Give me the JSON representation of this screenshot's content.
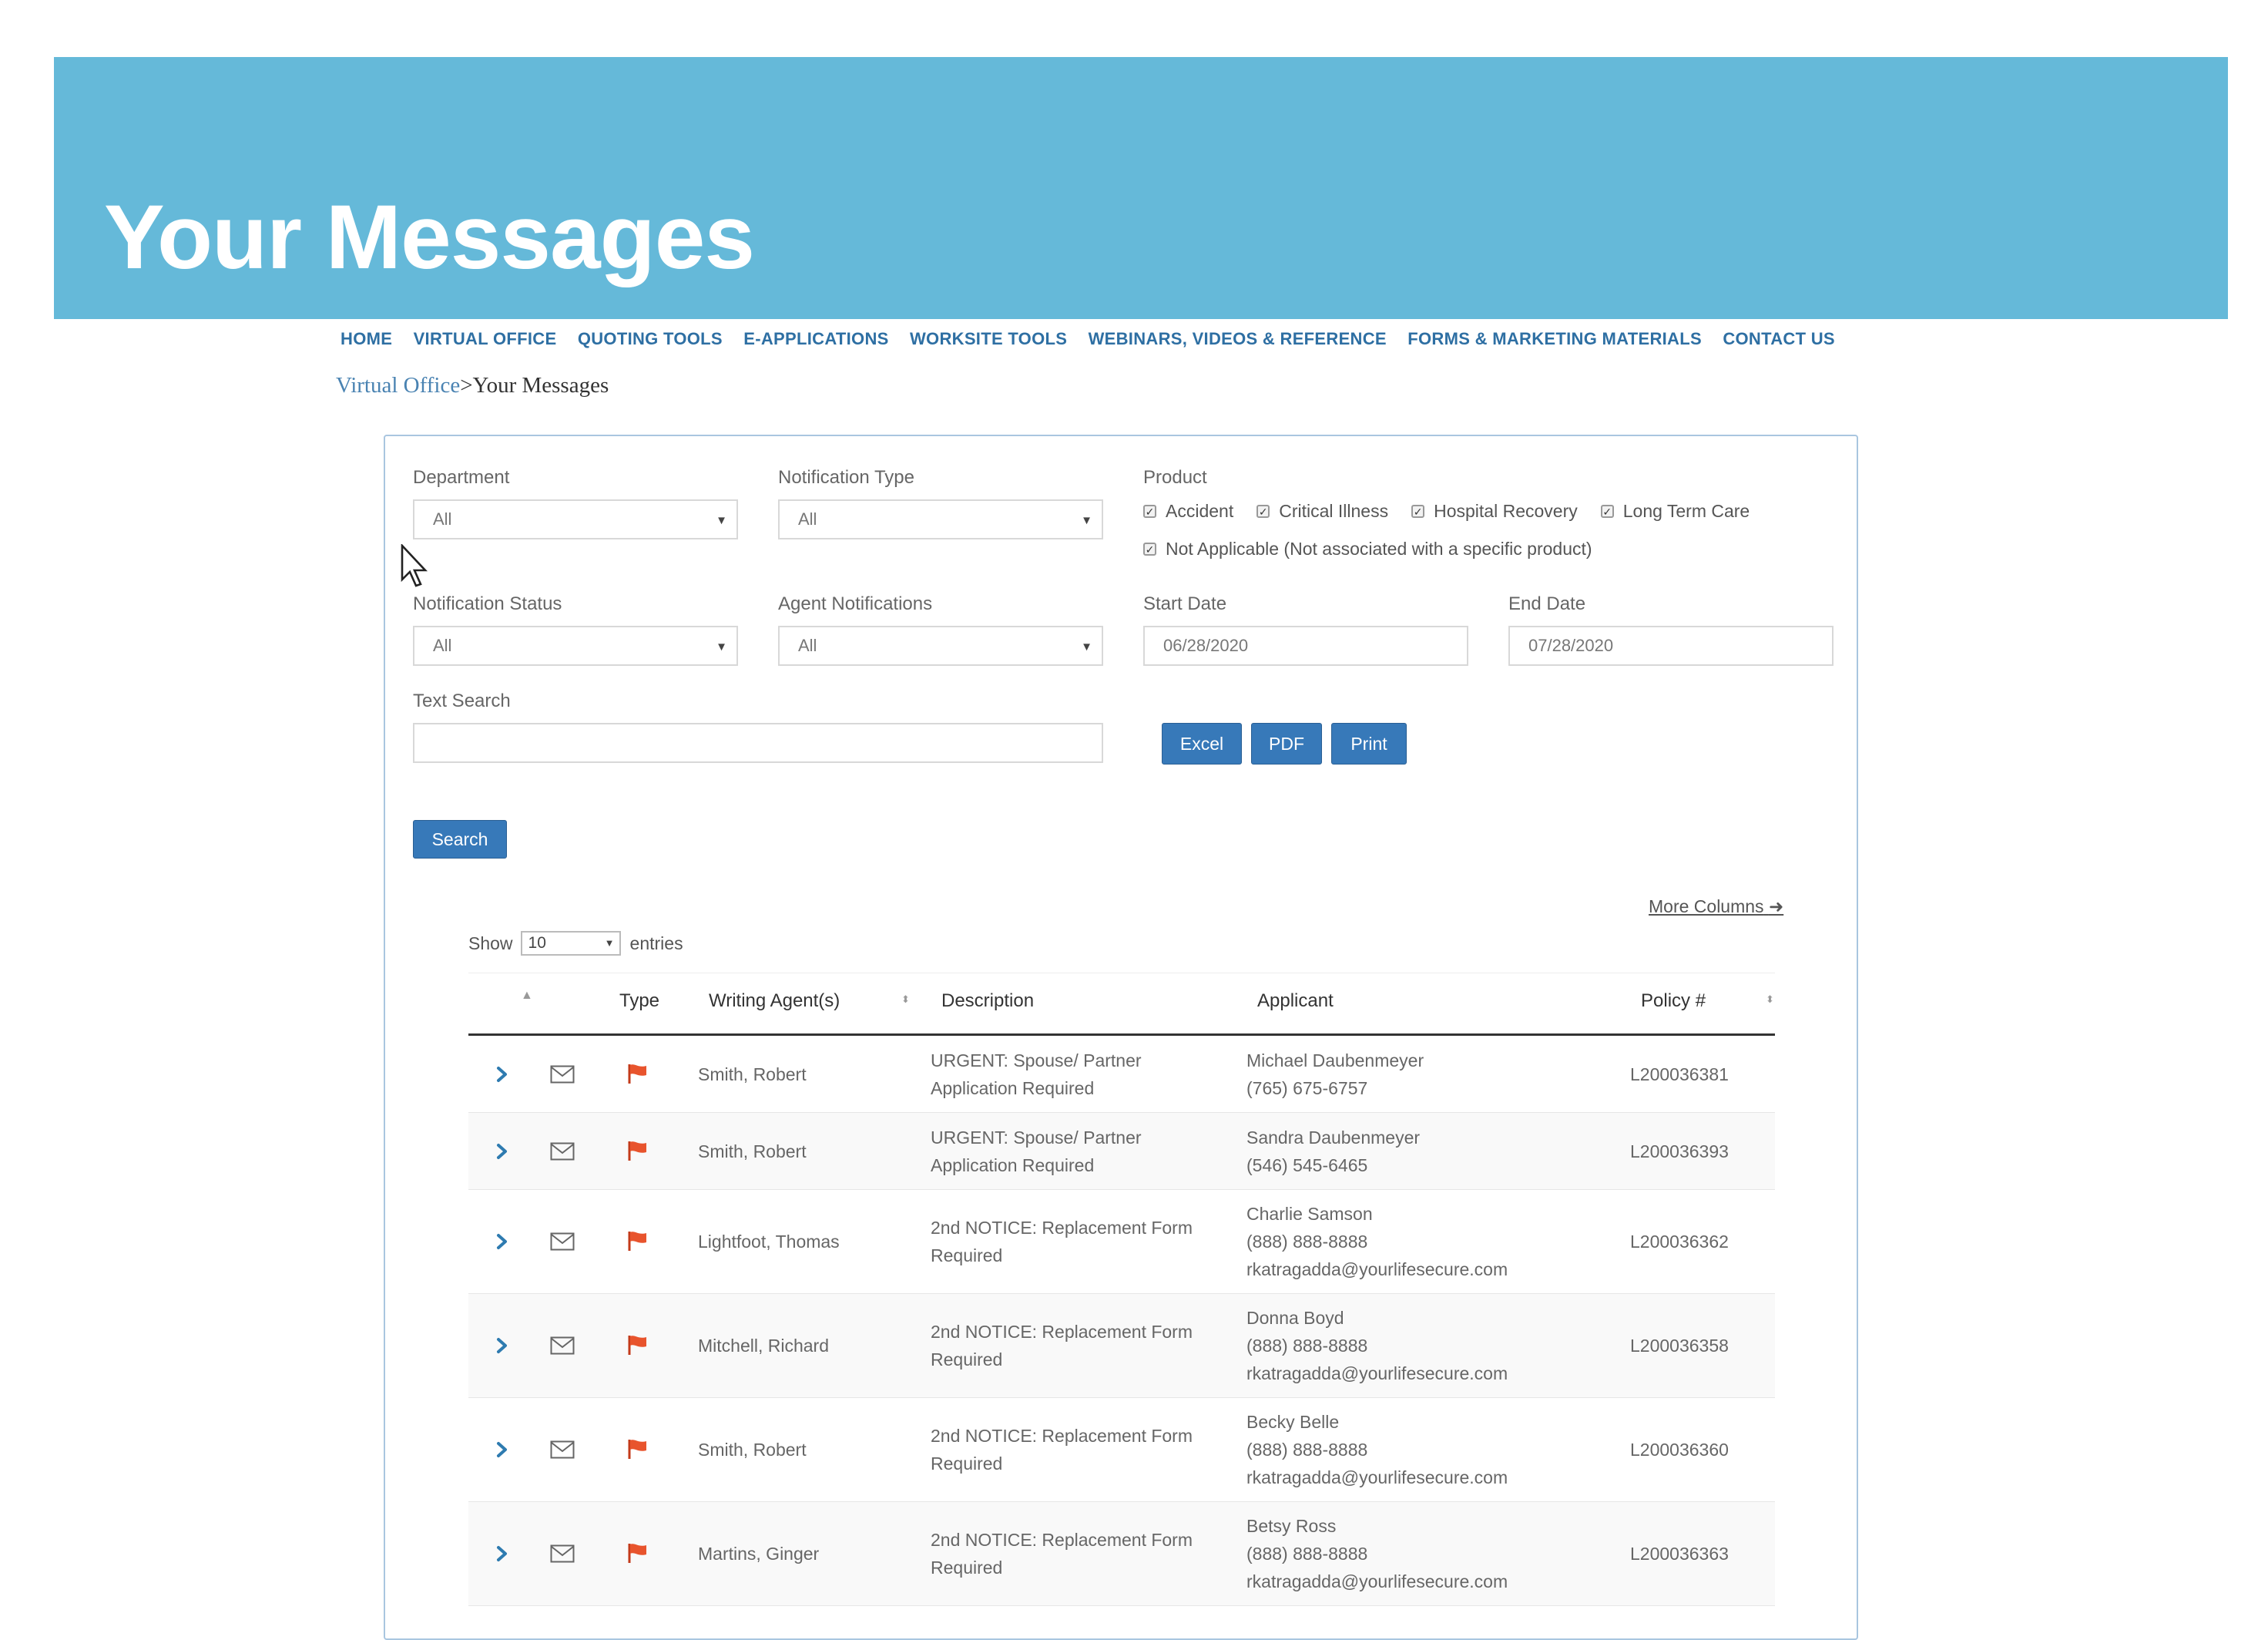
{
  "header": {
    "title": "Your Messages"
  },
  "nav": [
    "HOME",
    "VIRTUAL OFFICE",
    "QUOTING TOOLS",
    "E-APPLICATIONS",
    "WORKSITE TOOLS",
    "WEBINARS, VIDEOS & REFERENCE",
    "FORMS & MARKETING MATERIALS",
    "CONTACT US"
  ],
  "breadcrumb": {
    "link": "Virtual Office",
    "separator": ">",
    "current": "Your Messages"
  },
  "filters": {
    "department": {
      "label": "Department",
      "value": "All"
    },
    "notification_type": {
      "label": "Notification Type",
      "value": "All"
    },
    "product": {
      "label": "Product",
      "options": [
        "Accident",
        "Critical Illness",
        "Hospital Recovery",
        "Long Term Care"
      ],
      "other_option": "Not Applicable (Not associated with a specific product)"
    },
    "notification_status": {
      "label": "Notification Status",
      "value": "All"
    },
    "agent_notifications": {
      "label": "Agent Notifications",
      "value": "All"
    },
    "start_date": {
      "label": "Start Date",
      "value": "06/28/2020"
    },
    "end_date": {
      "label": "End Date",
      "value": "07/28/2020"
    },
    "text_search": {
      "label": "Text Search",
      "value": ""
    }
  },
  "buttons": {
    "excel": "Excel",
    "pdf": "PDF",
    "print": "Print",
    "search": "Search"
  },
  "more_columns": "More Columns",
  "show_entries": {
    "show": "Show",
    "value": "10",
    "entries": "entries"
  },
  "table": {
    "columns": {
      "type": "Type",
      "writing_agent": "Writing Agent(s)",
      "description": "Description",
      "applicant": "Applicant",
      "policy": "Policy #"
    },
    "rows": [
      {
        "agent": "Smith, Robert",
        "desc1": "URGENT: Spouse/ Partner",
        "desc2": "Application Required",
        "applicant_name": "Michael Daubenmeyer",
        "applicant_phone": "(765) 675-6757",
        "applicant_email": "",
        "policy": "L200036381"
      },
      {
        "agent": "Smith, Robert",
        "desc1": "URGENT: Spouse/ Partner",
        "desc2": "Application Required",
        "applicant_name": "Sandra Daubenmeyer",
        "applicant_phone": "(546) 545-6465",
        "applicant_email": "",
        "policy": "L200036393"
      },
      {
        "agent": "Lightfoot, Thomas",
        "desc1": "2nd NOTICE: Replacement Form",
        "desc2": "Required",
        "applicant_name": "Charlie Samson",
        "applicant_phone": "(888) 888-8888",
        "applicant_email": "rkatragadda@yourlifesecure.com",
        "policy": "L200036362"
      },
      {
        "agent": "Mitchell, Richard",
        "desc1": "2nd NOTICE: Replacement Form",
        "desc2": "Required",
        "applicant_name": "Donna Boyd",
        "applicant_phone": "(888) 888-8888",
        "applicant_email": "rkatragadda@yourlifesecure.com",
        "policy": "L200036358"
      },
      {
        "agent": "Smith, Robert",
        "desc1": "2nd NOTICE: Replacement Form",
        "desc2": "Required",
        "applicant_name": "Becky Belle",
        "applicant_phone": "(888) 888-8888",
        "applicant_email": "rkatragadda@yourlifesecure.com",
        "policy": "L200036360"
      },
      {
        "agent": "Martins, Ginger",
        "desc1": "2nd NOTICE: Replacement Form",
        "desc2": "Required",
        "applicant_name": "Betsy Ross",
        "applicant_phone": "(888) 888-8888",
        "applicant_email": "rkatragadda@yourlifesecure.com",
        "policy": "L200036363"
      }
    ]
  },
  "colors": {
    "banner": "#65b9d9",
    "nav": "#2e6fa3",
    "button": "#3779b9",
    "flag": "#e8542d",
    "chevron": "#2e7bb0"
  },
  "icons": [
    "expand-chevron-icon",
    "envelope-icon",
    "flag-icon",
    "cursor-icon"
  ]
}
